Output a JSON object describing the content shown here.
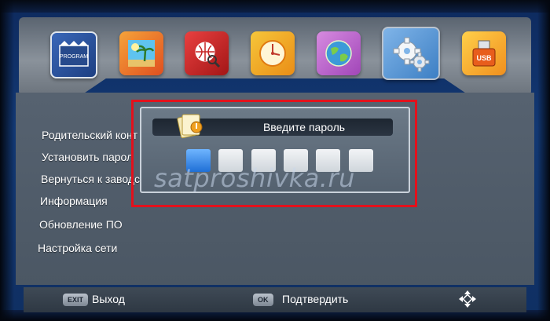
{
  "menu_icons": [
    {
      "name": "program-icon",
      "label": "PROGRAM"
    },
    {
      "name": "picture-icon"
    },
    {
      "name": "search-icon"
    },
    {
      "name": "clock-icon"
    },
    {
      "name": "globe-icon"
    },
    {
      "name": "gears-icon"
    },
    {
      "name": "usb-icon",
      "label": "USB"
    }
  ],
  "menu_items": [
    "Родительский конт",
    "Установить парол",
    "Вернуться к заводским установкам",
    "Информация",
    "Обновление ПО",
    "Настройка сети"
  ],
  "dialog": {
    "title": "Введите пароль",
    "password_slots": 6,
    "active_slot": 1
  },
  "footer": {
    "exit_key": "EXIT",
    "exit_label": "Выход",
    "ok_key": "OK",
    "ok_label": "Подтвердить"
  },
  "watermark": "satproshivka.ru",
  "colors": {
    "highlight_frame": "#e3111c",
    "active_slot": "#1f6fd6"
  }
}
